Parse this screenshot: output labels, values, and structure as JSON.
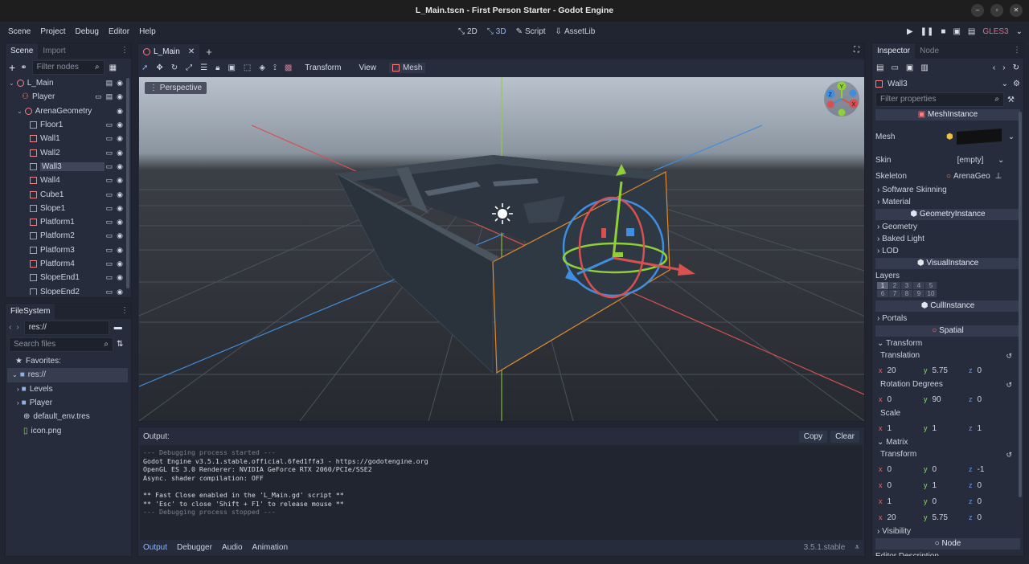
{
  "window": {
    "title": "L_Main.tscn - First Person Starter - Godot Engine"
  },
  "menu": [
    "Scene",
    "Project",
    "Debug",
    "Editor",
    "Help"
  ],
  "workspaces": [
    {
      "label": "2D"
    },
    {
      "label": "3D"
    },
    {
      "label": "Script"
    },
    {
      "label": "AssetLib"
    }
  ],
  "renderer": "GLES3",
  "scene_dock": {
    "tabs": [
      "Scene",
      "Import"
    ],
    "filter_placeholder": "Filter nodes",
    "nodes": [
      {
        "label": "L_Main",
        "depth": 0
      },
      {
        "label": "Player",
        "depth": 1
      },
      {
        "label": "ArenaGeometry",
        "depth": 1
      },
      {
        "label": "Floor1",
        "depth": 2
      },
      {
        "label": "Wall1",
        "depth": 2
      },
      {
        "label": "Wall2",
        "depth": 2
      },
      {
        "label": "Wall3",
        "depth": 2,
        "selected": true
      },
      {
        "label": "Wall4",
        "depth": 2
      },
      {
        "label": "Cube1",
        "depth": 2
      },
      {
        "label": "Slope1",
        "depth": 2
      },
      {
        "label": "Platform1",
        "depth": 2
      },
      {
        "label": "Platform2",
        "depth": 2
      },
      {
        "label": "Platform3",
        "depth": 2
      },
      {
        "label": "Platform4",
        "depth": 2
      },
      {
        "label": "SlopeEnd1",
        "depth": 2
      },
      {
        "label": "SlopeEnd2",
        "depth": 2
      }
    ]
  },
  "filesystem": {
    "tab": "FileSystem",
    "path": "res://",
    "search_placeholder": "Search files",
    "favorites_label": "Favorites:",
    "items": [
      {
        "label": "res://",
        "type": "folder"
      },
      {
        "label": "Levels",
        "type": "folder"
      },
      {
        "label": "Player",
        "type": "folder"
      },
      {
        "label": "default_env.tres",
        "type": "resource"
      },
      {
        "label": "icon.png",
        "type": "image"
      }
    ]
  },
  "viewport": {
    "tab": "L_Main",
    "toolbar_menus": [
      "Transform",
      "View",
      "Mesh"
    ],
    "perspective_label": "Perspective"
  },
  "output": {
    "header": "Output:",
    "copy": "Copy",
    "clear": "Clear",
    "lines": [
      "--- Debugging process started ---",
      "Godot Engine v3.5.1.stable.official.6fed1ffa3 - https://godotengine.org",
      "OpenGL ES 3.0 Renderer: NVIDIA GeForce RTX 2060/PCIe/SSE2",
      "Async. shader compilation: OFF",
      "",
      "** Fast Close enabled in the 'L_Main.gd' script **",
      "** 'Esc' to close 'Shift + F1' to release mouse **",
      "--- Debugging process stopped ---"
    ],
    "bottom_tabs": [
      "Output",
      "Debugger",
      "Audio",
      "Animation"
    ],
    "version": "3.5.1.stable"
  },
  "inspector": {
    "tabs": [
      "Inspector",
      "Node"
    ],
    "node_name": "Wall3",
    "filter_placeholder": "Filter properties",
    "sections": {
      "mesh_instance": "MeshInstance",
      "geometry_instance": "GeometryInstance",
      "visual_instance": "VisualInstance",
      "cull_instance": "CullInstance",
      "spatial": "Spatial",
      "node": "Node"
    },
    "mesh_label": "Mesh",
    "skin_label": "Skin",
    "skin_value": "[empty]",
    "skeleton_label": "Skeleton",
    "skeleton_value": "ArenaGeo",
    "software_skinning": "Software Skinning",
    "material": "Material",
    "geometry": "Geometry",
    "baked_light": "Baked Light",
    "lod": "LOD",
    "layers_label": "Layers",
    "layers": [
      "1",
      "2",
      "3",
      "4",
      "5",
      "6",
      "7",
      "8",
      "9",
      "10"
    ],
    "portals": "Portals",
    "transform": "Transform",
    "translation_label": "Translation",
    "translation": {
      "x": "20",
      "y": "5.75",
      "z": "0"
    },
    "rotation_label": "Rotation Degrees",
    "rotation": {
      "x": "0",
      "y": "90",
      "z": "0"
    },
    "scale_label": "Scale",
    "scale": {
      "x": "1",
      "y": "1",
      "z": "1"
    },
    "matrix": "Matrix",
    "matrix_transform": "Transform",
    "matrix_rows": [
      {
        "x": "0",
        "y": "0",
        "z": "-1"
      },
      {
        "x": "0",
        "y": "1",
        "z": "0"
      },
      {
        "x": "1",
        "y": "0",
        "z": "0"
      },
      {
        "x": "20",
        "y": "5.75",
        "z": "0"
      }
    ],
    "visibility": "Visibility",
    "editor_description": "Editor Description"
  }
}
